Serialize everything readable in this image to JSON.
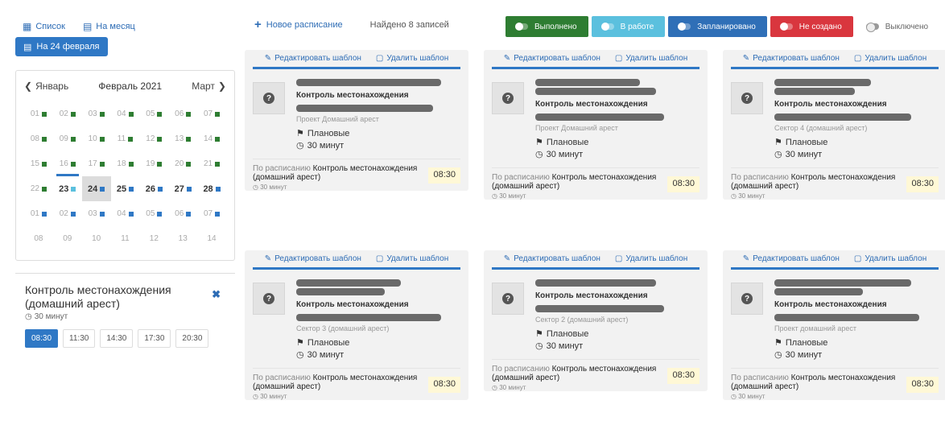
{
  "nav": {
    "list_label": "Список",
    "month_label": "На месяц",
    "date_button": "На 24 февраля"
  },
  "calendar": {
    "prev": "Январь",
    "current": "Февраль 2021",
    "next": "Март",
    "rows": [
      [
        {
          "d": "01",
          "m": "g"
        },
        {
          "d": "02",
          "m": "g"
        },
        {
          "d": "03",
          "m": "g"
        },
        {
          "d": "04",
          "m": "g"
        },
        {
          "d": "05",
          "m": "g"
        },
        {
          "d": "06",
          "m": "g"
        },
        {
          "d": "07",
          "m": "g"
        }
      ],
      [
        {
          "d": "08",
          "m": "g"
        },
        {
          "d": "09",
          "m": "g"
        },
        {
          "d": "10",
          "m": "g"
        },
        {
          "d": "11",
          "m": "g"
        },
        {
          "d": "12",
          "m": "g"
        },
        {
          "d": "13",
          "m": "g"
        },
        {
          "d": "14",
          "m": "g"
        }
      ],
      [
        {
          "d": "15",
          "m": "g"
        },
        {
          "d": "16",
          "m": "g"
        },
        {
          "d": "17",
          "m": "g"
        },
        {
          "d": "18",
          "m": "g"
        },
        {
          "d": "19",
          "m": "g"
        },
        {
          "d": "20",
          "m": "g"
        },
        {
          "d": "21",
          "m": "g"
        }
      ],
      [
        {
          "d": "22",
          "m": "g"
        },
        {
          "d": "23",
          "m": "l",
          "a": 1,
          "t": 1
        },
        {
          "d": "24",
          "m": "b",
          "a": 1,
          "s": 1
        },
        {
          "d": "25",
          "m": "b",
          "a": 1
        },
        {
          "d": "26",
          "m": "b",
          "a": 1
        },
        {
          "d": "27",
          "m": "b",
          "a": 1
        },
        {
          "d": "28",
          "m": "b",
          "a": 1
        }
      ],
      [
        {
          "d": "01",
          "m": "b"
        },
        {
          "d": "02",
          "m": "b"
        },
        {
          "d": "03",
          "m": "b"
        },
        {
          "d": "04",
          "m": "b"
        },
        {
          "d": "05",
          "m": "b"
        },
        {
          "d": "06",
          "m": "b"
        },
        {
          "d": "07",
          "m": "b"
        }
      ],
      [
        {
          "d": "08"
        },
        {
          "d": "09"
        },
        {
          "d": "10"
        },
        {
          "d": "11"
        },
        {
          "d": "12"
        },
        {
          "d": "13"
        },
        {
          "d": "14"
        }
      ]
    ]
  },
  "detail": {
    "title": "Контроль местонахождения (домашний арест)",
    "duration": "30 минут",
    "slots": [
      "08:30",
      "11:30",
      "14:30",
      "17:30",
      "20:30"
    ],
    "active_slot": "08:30"
  },
  "toolbar": {
    "new_schedule": "Новое расписание",
    "found": "Найдено 8 записей"
  },
  "legend": [
    {
      "label": "Выполнено",
      "color": "#2e7d32"
    },
    {
      "label": "В работе",
      "color": "#5bc0de"
    },
    {
      "label": "Запланировано",
      "color": "#2f6fb7"
    },
    {
      "label": "Не создано",
      "color": "#d9363e"
    },
    {
      "label": "Выключено",
      "color": ""
    }
  ],
  "colors": {
    "green": "#2e7d32",
    "blue": "#2f78c5",
    "light_blue": "#5bc0de",
    "red": "#d9363e"
  },
  "card_actions": {
    "edit": "Редактировать шаблон",
    "delete": "Удалить шаблон"
  },
  "cards": [
    {
      "control": "Контроль местонахождения",
      "project": "Проект Домашний арест",
      "type": "Плановые",
      "duration": "30 минут",
      "sched_prefix": "По расписанию",
      "sched_name": "Контроль местонахождения (домашний арест)",
      "sched_dur": "30 минут",
      "time": "08:30"
    },
    {
      "control": "Контроль местонахождения",
      "project": "Проект Домашний арест",
      "type": "Плановые",
      "duration": "30 минут",
      "sched_prefix": "По расписанию",
      "sched_name": "Контроль местонахождения (домашний арест)",
      "sched_dur": "30 минут",
      "time": "08:30"
    },
    {
      "control": "Контроль местонахождения",
      "project": "Сектор 4 (домашний арест)",
      "type": "Плановые",
      "duration": "30 минут",
      "sched_prefix": "По расписанию",
      "sched_name": "Контроль местонахождения (домашний арест)",
      "sched_dur": "30 минут",
      "time": "08:30"
    },
    {
      "control": "Контроль местонахождения",
      "project": "Сектор 3 (домашний арест)",
      "type": "Плановые",
      "duration": "30 минут",
      "sched_prefix": "По расписанию",
      "sched_name": "Контроль местонахождения (домашний арест)",
      "sched_dur": "30 минут",
      "time": "08:30"
    },
    {
      "control": "Контроль местонахождения",
      "project": "Сектор 2 (домашний арест)",
      "type": "Плановые",
      "duration": "30 минут",
      "sched_prefix": "По расписанию",
      "sched_name": "Контроль местонахождения (домашний арест)",
      "sched_dur": "30 минут",
      "time": "08:30"
    },
    {
      "control": "Контроль местонахождения",
      "project": "Проект домашний арест",
      "type": "Плановые",
      "duration": "30 минут",
      "sched_prefix": "По расписанию",
      "sched_name": "Контроль местонахождения (домашний арест)",
      "sched_dur": "30 минут",
      "time": "08:30"
    }
  ]
}
